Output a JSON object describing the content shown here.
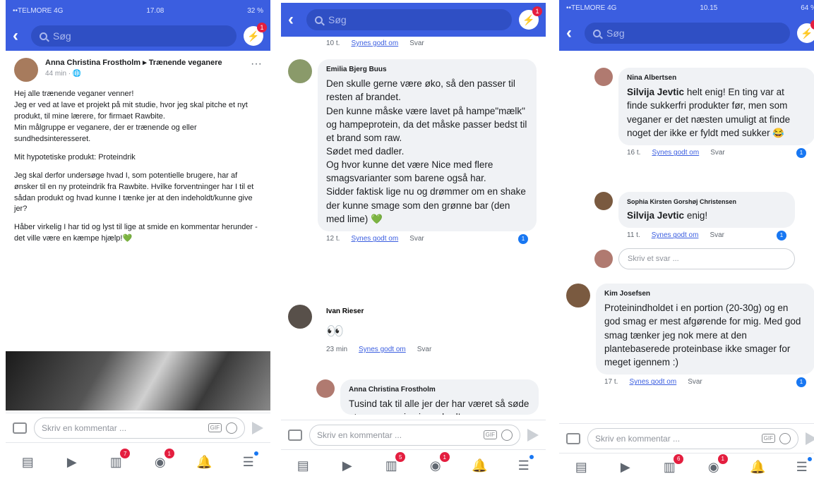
{
  "search": {
    "placeholder": "Søg"
  },
  "messenger": {
    "badge": "1"
  },
  "screen1": {
    "status_left": "••TELMORE 4G",
    "status_time": "17.08",
    "status_right": "32 %",
    "author": "Anna Christina Frostholm ▸ Trænende veganere",
    "time": "44 min · 🌐",
    "paragraphs": [
      "Hej alle trænende veganer venner!\nJeg er ved at lave et projekt på mit studie, hvor jeg skal pitche et nyt produkt, til mine lærere, for firmaet Rawbite.\nMin målgruppe er veganere, der er trænende og eller sundhedsinteresseret.",
      "Mit hypotetiske produkt: Proteindrik",
      "Jeg skal derfor undersøge hvad I, som potentielle brugere, har af ønsker til en ny proteindrik fra Rawbite. Hvilke forventninger har I til et sådan produkt og hvad kunne I tænke jer at den indeholdt/kunne give jer?",
      "Håber virkelig I har tid og lyst til lige at smide en kommentar herunder - det ville være en kæmpe hjælp!💚"
    ]
  },
  "composer": {
    "placeholder": "Skriv en kommentar ...",
    "gif": "GIF"
  },
  "tabbar": {
    "badges": [
      "7",
      "1"
    ]
  },
  "screen2": {
    "top_actions": {
      "time": "10 t.",
      "like": "Synes godt om",
      "reply": "Svar"
    },
    "c1": {
      "name": "Emilia Bjerg Buus",
      "text": "Den skulle gerne være øko, så den passer til resten af brandet.\nDen kunne måske være lavet på hampe\"mælk\" og hampeprotein, da det måske passer bedst til et brand som raw.\nSødet med dadler.\nOg hvor kunne det være Nice med flere smagsvarianter som barene også har.\nSidder faktisk lige nu og drømmer om en shake der kunne smage som den grønne bar (den med lime) 💚",
      "time": "12 t.",
      "like": "Synes godt om",
      "reply": "Svar",
      "count": "1"
    },
    "c2": {
      "name": "Ivan Rieser",
      "text": "👀",
      "time": "23 min",
      "like": "Synes godt om",
      "reply": "Svar"
    },
    "c3": {
      "name": "Anna Christina Frostholm",
      "text": "Tusind tak til alle jer der har været så søde at svare og give jeres bud!"
    },
    "badges": [
      "5",
      "1"
    ]
  },
  "screen3": {
    "status_left": "••TELMORE 4G",
    "status_time": "10.15",
    "status_right": "64 %",
    "c1": {
      "name": "Nina Albertsen",
      "mention": "Silvija Jevtic",
      "text": " helt enig! En ting var at finde sukkerfri produkter før, men som veganer er det næsten umuligt at finde noget der ikke er fyldt med sukker 😂",
      "time": "16 t.",
      "like": "Synes godt om",
      "reply": "Svar",
      "count": "1"
    },
    "c2": {
      "name": "Sophia Kirsten Gorshøj Christensen",
      "mention": "Silvija Jevtic",
      "text": " enig!",
      "time": "11 t.",
      "like": "Synes godt om",
      "reply": "Svar",
      "count": "1"
    },
    "reply_placeholder": "Skriv et svar ...",
    "c3": {
      "name": "Kim Josefsen",
      "text": "Proteinindholdet i en portion (20-30g) og en god smag er mest afgørende for mig. Med god smag tænker jeg nok mere at den plantebaserede proteinbase ikke smager for meget igennem :)",
      "time": "17 t.",
      "like": "Synes godt om",
      "reply": "Svar",
      "count": "1"
    },
    "badges": [
      "6",
      "1"
    ]
  }
}
